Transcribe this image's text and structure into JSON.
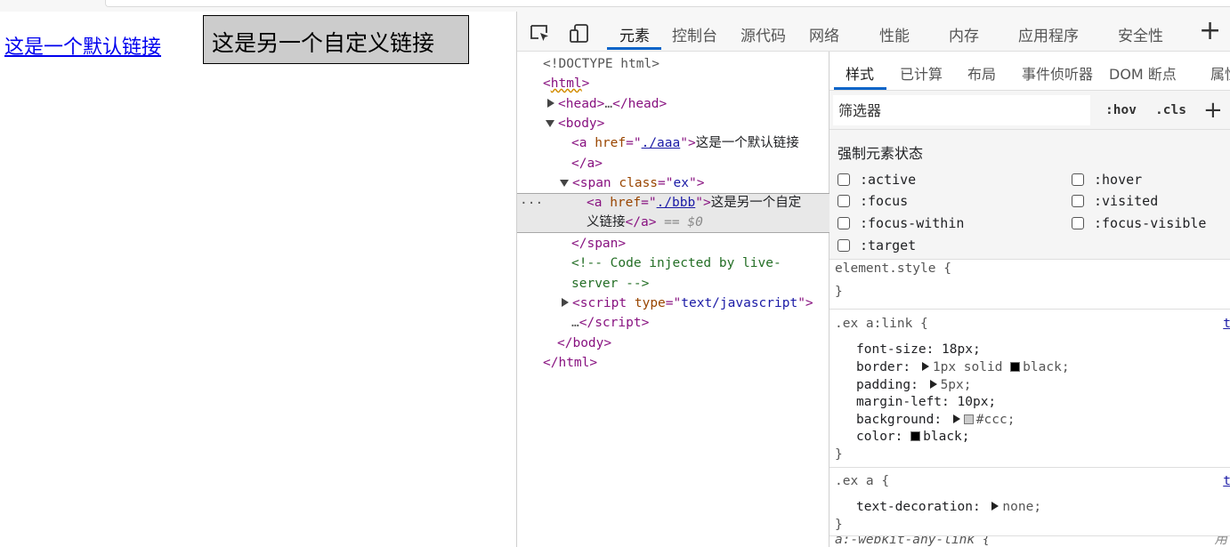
{
  "page": {
    "link1_text": "这是一个默认链接",
    "link2_text": "这是另一个自定义链接"
  },
  "devtools": {
    "tabs": [
      {
        "label": "元素"
      },
      {
        "label": "控制台"
      },
      {
        "label": "源代码"
      },
      {
        "label": "网络"
      },
      {
        "label": "性能"
      },
      {
        "label": "内存"
      },
      {
        "label": "应用程序"
      },
      {
        "label": "安全性"
      }
    ],
    "plus": "+",
    "tree": {
      "doctype": "<!DOCTYPE html>",
      "html_open": "html",
      "head_tag": "head",
      "ellipsis": "…",
      "body_tag": "body",
      "a_tag": "a",
      "href_attr": "href",
      "a1_href": "./aaa",
      "a1_text": "这是一个默认链接",
      "span_tag": "span",
      "class_attr": "class",
      "span_class": "ex",
      "a2_href": "./bbb",
      "a2_text_1": "这是另一个自定",
      "a2_text_2": "义链接",
      "eq0": "== $0",
      "dots": "···",
      "comment_1": "<!-- Code injected by live-",
      "comment_2": "server -->",
      "script_tag": "script",
      "type_attr": "type",
      "script_type": "text/javascript"
    },
    "styles": {
      "subtabs": [
        {
          "label": "样式"
        },
        {
          "label": "已计算"
        },
        {
          "label": "布局"
        },
        {
          "label": "事件侦听器"
        },
        {
          "label": "DOM 断点"
        },
        {
          "label": "属性"
        }
      ],
      "filter_placeholder": "筛选器",
      "hov": ":hov",
      "cls": ".cls",
      "force_title": "强制元素状态",
      "states": [
        ":active",
        ":hover",
        ":focus",
        ":visited",
        ":focus-within",
        ":focus-visible",
        ":target"
      ],
      "element_style": "element.style {",
      "close_brace": "}",
      "rule1": {
        "selector": ".ex a:link {",
        "src": "t",
        "props": [
          {
            "name": "font-size",
            "value": "18px;"
          },
          {
            "name": "border",
            "value": "1px solid black;"
          },
          {
            "name": "padding",
            "value": "5px;"
          },
          {
            "name": "margin-left",
            "value": "10px;"
          },
          {
            "name": "background",
            "value": "#ccc;"
          },
          {
            "name": "color",
            "value": "black;"
          }
        ]
      },
      "rule2": {
        "selector": ".ex a {",
        "src": "t",
        "props": [
          {
            "name": "text-decoration",
            "value": "none;"
          }
        ]
      },
      "rule3_selector": "a:-webkit-any-link {",
      "rule3_src": "用"
    },
    "colors": {
      "accent": "#0a64c8",
      "swatch_black": "#000000",
      "swatch_ccc": "#cccccc"
    }
  }
}
